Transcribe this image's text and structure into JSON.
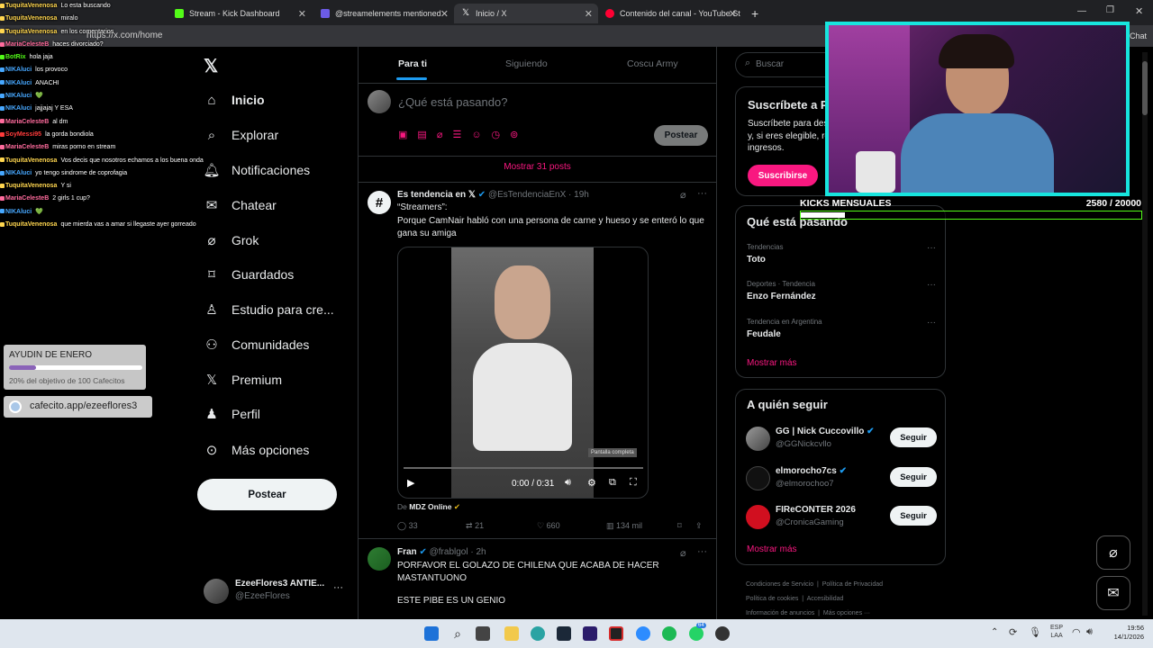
{
  "browser": {
    "tabs": [
      {
        "label": "Stream - Kick Dashboard",
        "color": "#53fc18"
      },
      {
        "label": "@streamelements mentioned",
        "color": "#6c5ce7"
      },
      {
        "label": "Inicio / X",
        "color": "#ffffff"
      },
      {
        "label": "Contenido del canal - YouTube St",
        "color": "#ff0033"
      }
    ],
    "new_tab": "+",
    "url": "https://x.com/home",
    "chat_label": "Chat"
  },
  "chat": {
    "messages": [
      {
        "user": "TuquitaVenenosa",
        "text": "Lo esta buscando",
        "color": "#ffd64f"
      },
      {
        "user": "TuquitaVenenosa",
        "text": "miralo",
        "color": "#ffd64f"
      },
      {
        "user": "TuquitaVenenosa",
        "text": "en los comentarios",
        "color": "#ffd64f"
      },
      {
        "user": "MariaCelesteB",
        "text": "haces divorciado?",
        "color": "#ff6b9d"
      },
      {
        "user": "BotRix",
        "text": "hola jaja",
        "color": "#53fc18"
      },
      {
        "user": "NIKAluci",
        "text": "los provoco",
        "color": "#47a8ff"
      },
      {
        "user": "NIKAluci",
        "text": "ANACHI",
        "color": "#47a8ff"
      },
      {
        "user": "NIKAluci",
        "text": "💚",
        "color": "#47a8ff"
      },
      {
        "user": "NIKAluci",
        "text": "jajjajaj Y ESA",
        "color": "#47a8ff"
      },
      {
        "user": "MariaCelesteB",
        "text": "al dm",
        "color": "#ff6b9d"
      },
      {
        "user": "SoyMessi95",
        "text": "la gorda bondiola",
        "color": "#ff3b3b"
      },
      {
        "user": "MariaCelesteB",
        "text": "miras porno en stream",
        "color": "#ff6b9d"
      },
      {
        "user": "TuquitaVenenosa",
        "text": "Vos decis que nosotros echamos a los buena onda",
        "color": "#ffd64f"
      },
      {
        "user": "NIKAluci",
        "text": "yo tengo sindrome de coprofagia",
        "color": "#47a8ff"
      },
      {
        "user": "TuquitaVenenosa",
        "text": "Y si",
        "color": "#ffd64f"
      },
      {
        "user": "MariaCelesteB",
        "text": "2 girls 1 cup?",
        "color": "#ff6b9d"
      },
      {
        "user": "NIKAluci",
        "text": "💚",
        "color": "#47a8ff"
      },
      {
        "user": "TuquitaVenenosa",
        "text": "que mierda vas a amar si llegaste ayer gorreado",
        "color": "#ffd64f"
      }
    ]
  },
  "widgets": {
    "goal_title": "AYUDIN DE ENERO",
    "goal_progress": 0.2,
    "goal_text": "20% del objetivo de 100 Cafecitos",
    "cafecito": "cafecito.app/ezeeflores3",
    "kicks_label": "KICKS MENSUALES",
    "kicks_value": "2580  / 20000",
    "kicks_progress": 0.129
  },
  "nav": {
    "items": [
      {
        "label": "Inicio",
        "icon": "home-icon"
      },
      {
        "label": "Explorar",
        "icon": "search-icon"
      },
      {
        "label": "Notificaciones",
        "icon": "bell-icon"
      },
      {
        "label": "Chatear",
        "icon": "mail-icon"
      },
      {
        "label": "Grok",
        "icon": "grok-icon"
      },
      {
        "label": "Guardados",
        "icon": "bookmark-icon"
      },
      {
        "label": "Estudio para cre...",
        "icon": "flask-icon"
      },
      {
        "label": "Comunidades",
        "icon": "people-icon"
      },
      {
        "label": "Premium",
        "icon": "x-icon"
      },
      {
        "label": "Perfil",
        "icon": "person-icon"
      },
      {
        "label": "Más opciones",
        "icon": "more-icon"
      }
    ],
    "post_button": "Postear",
    "account_name": "EzeeFlores3 ANTIE...",
    "account_handle": "@EzeeFlores",
    "account_more": "···"
  },
  "feed": {
    "tabs": [
      "Para ti",
      "Siguiendo",
      "Coscu Army"
    ],
    "compose_placeholder": "¿Qué está pasando?",
    "compose_button": "Postear",
    "show_posts": "Mostrar 31 posts",
    "post1": {
      "name": "Es tendencia en 𝕏",
      "handle": "@EsTendenciaEnX · 19h",
      "line1": "“Streamers”:",
      "line2": "Porque CamNair habló con una persona de carne y hueso y se enteró lo que gana su amiga",
      "video_time": "0:00 / 0:31",
      "tooltip": "Pantalla completa",
      "source_prefix": "De",
      "source": "MDZ Online",
      "replies": "33",
      "reposts": "21",
      "likes": "660",
      "views": "134 mil"
    },
    "post2": {
      "name": "Fran",
      "handle": "@frablgol · 2h",
      "text": "PORFAVOR EL GOLAZO DE CHILENA QUE ACABA DE HACER MASTANTUONO",
      "text2": "ESTE PIBE ES UN GENIO"
    }
  },
  "right": {
    "search_placeholder": "Buscar",
    "subscribe_title": "Suscríbete a Premium",
    "subscribe_text": "Suscríbete para desbloquear nuevas funciones y, si eres elegible, recibir un pago de cuota de ingresos.",
    "subscribe_button": "Suscribirse",
    "trends_title": "Qué está pasando",
    "trends": [
      {
        "context": "Tendencias",
        "name": "Toto"
      },
      {
        "context": "Deportes · Tendencia",
        "name": "Enzo Fernández"
      },
      {
        "context": "Tendencia en Argentina",
        "name": "Feudale"
      }
    ],
    "show_more": "Mostrar más",
    "follow_title": "A quién seguir",
    "follow": [
      {
        "name": "GG | Nick Cuccovillo",
        "handle": "@GGNickcvllo",
        "button": "Seguir"
      },
      {
        "name": "elmorocho7cs",
        "handle": "@elmorochoo7",
        "button": "Seguir"
      },
      {
        "name": "FIReCONTER 2026",
        "handle": "@CronicaGaming",
        "button": "Seguir"
      }
    ],
    "show_more2": "Mostrar más",
    "footer": [
      "Condiciones de Servicio",
      "Política de Privacidad",
      "Política de cookies",
      "Accesibilidad",
      "Información de anuncios",
      "Más opciones ···"
    ]
  },
  "taskbar": {
    "lang1": "ESP",
    "lang2": "LAA",
    "time": "19:56",
    "date": "14/1/2026",
    "badge": "64"
  }
}
